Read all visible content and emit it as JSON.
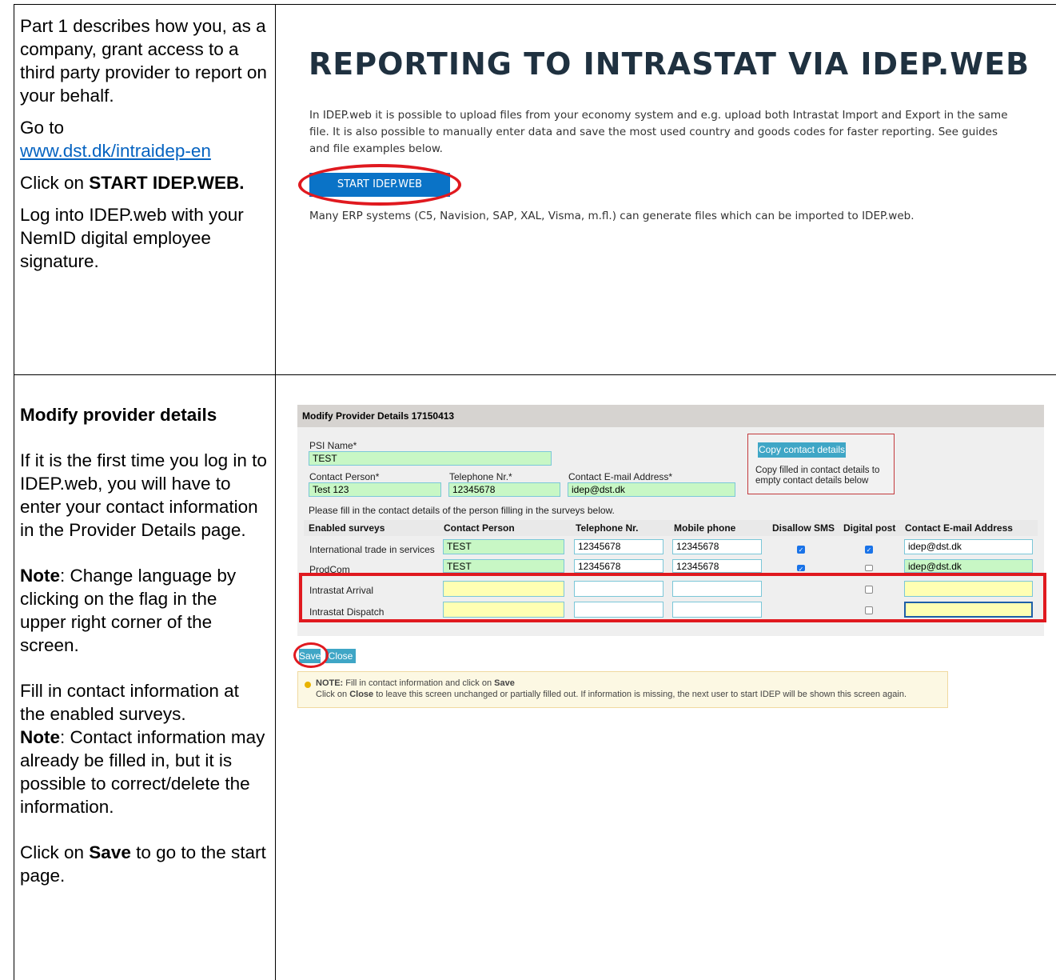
{
  "left_top": {
    "p1": "Part 1 describes how you, as a company, grant access to a third party provider to report on your behalf.",
    "p2_goto": "Go to",
    "p2_link": "www.dst.dk/intraidep-en",
    "p3_prefix": "Click on",
    "p3_bold": "START IDEP.WEB.",
    "p4": "Log into IDEP.web with your NemID digital employee signature."
  },
  "shot_top": {
    "title": "REPORTING TO INTRASTAT VIA IDEP.WEB",
    "intro": "In IDEP.web it is possible to upload files from your economy system and e.g. upload both Intrastat Import and Export in the same file. It is also possible to manually enter data and save the most used country and goods codes for faster reporting. See guides and file examples below.",
    "start_button": "START IDEP.WEB",
    "erp_text": "Many ERP systems (C5, Navision, SAP, XAL, Visma, m.fl.) can generate files which can be imported to IDEP.web."
  },
  "left_bottom": {
    "heading": "Modify provider details",
    "p1": "If it is the first time you log in to IDEP.web, you will have to enter your contact information in the Provider Details page.",
    "note1_bold": "Note",
    "note1_rest": ": Change language by clicking on the flag in the upper right corner of the screen.",
    "p3": "Fill in contact information at the enabled surveys.",
    "note2_bold": "Note",
    "note2_rest": ": Contact information may already be filled in, but it is possible to correct/delete the information.",
    "p5_prefix": "Click on",
    "p5_bold": "Save",
    "p5_rest": "to go to the start page."
  },
  "form": {
    "header": "Modify Provider Details 17150413",
    "psi_label": "PSI Name*",
    "psi_value": "TEST",
    "contact_label": "Contact Person*",
    "contact_value": "Test 123",
    "tel_label": "Telephone Nr.*",
    "tel_value": "12345678",
    "email_label": "Contact E-mail Address*",
    "email_value": "idep@dst.dk",
    "copy_button": "Copy contact details",
    "copy_desc": "Copy filled in contact details to empty contact details below",
    "instruction": "Please fill in the contact details of the person filling in the surveys below.",
    "columns": [
      "Enabled surveys",
      "Contact Person",
      "Telephone Nr.",
      "Mobile phone",
      "Disallow SMS",
      "Digital post",
      "Contact E-mail Address"
    ],
    "rows": [
      {
        "survey": "International trade in services",
        "contact": "TEST",
        "tel": "12345678",
        "mobile": "12345678",
        "email": "idep@dst.dk"
      },
      {
        "survey": "ProdCom",
        "contact": "TEST",
        "tel": "12345678",
        "mobile": "12345678",
        "email": "idep@dst.dk"
      },
      {
        "survey": "Intrastat Arrival",
        "contact": "",
        "tel": "",
        "mobile": "",
        "email": ""
      },
      {
        "survey": "Intrastat Dispatch",
        "contact": "",
        "tel": "",
        "mobile": "",
        "email": ""
      }
    ],
    "save_button": "Save",
    "close_button": "Close",
    "note_label": "NOTE:",
    "note_l1_rest": "Fill in contact information and click on",
    "note_l1_bold": "Save",
    "note_l2_prefix": "Click on",
    "note_l2_bold": "Close",
    "note_l2_rest": "to leave this screen unchanged or partially filled out. If information is missing, the next user to start IDEP will be shown this screen again."
  }
}
